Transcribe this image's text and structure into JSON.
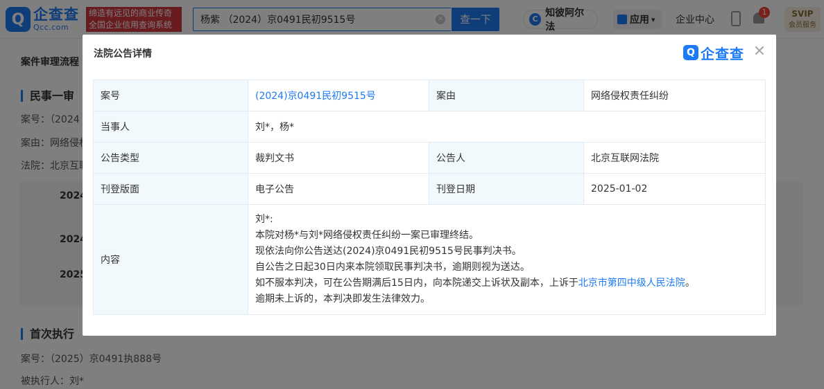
{
  "header": {
    "logo_mark": "Q",
    "logo_cn": "企查查",
    "logo_en": "Qcc.com",
    "slogan_line1": "缔造有远见的商业传奇",
    "slogan_line2": "全国企业信用查询系统",
    "search_value": "杨紫 （2024）京0491民初9515号",
    "search_clear": "✕",
    "search_button": "查一下",
    "zhibi_icon": "C",
    "zhibi_label": "知彼阿尔法",
    "apps_label": "应用",
    "apps_caret": "▾",
    "center_label": "企业中心",
    "notification_count": "1",
    "svip_title": "SVIP",
    "svip_sub": "会员服务"
  },
  "background": {
    "process_title": "案件审理流程",
    "first_trial_title": "民事一审",
    "case_no_line": "案号：（2024",
    "cause_line": "案由：网络侵权",
    "court_line": "法院：北京互联",
    "timeline_items": [
      "2024",
      "2024",
      "2025"
    ],
    "exec_title": "首次执行",
    "exec_case_line": "案号：（2025）京0491执888号",
    "exec_person_line": "被执行人：刘*"
  },
  "modal": {
    "title": "法院公告详情",
    "logo_mark": "Q",
    "logo_text": "企查查",
    "close": "✕",
    "rows": {
      "case_no_label": "案号",
      "case_no_value": "(2024)京0491民初9515号",
      "cause_label": "案由",
      "cause_value": "网络侵权责任纠纷",
      "parties_label": "当事人",
      "parties_value": "刘*，杨*",
      "type_label": "公告类型",
      "type_value": "裁判文书",
      "announcer_label": "公告人",
      "announcer_value": "北京互联网法院",
      "layout_label": "刊登版面",
      "layout_value": "电子公告",
      "date_label": "刊登日期",
      "date_value": "2025-01-02",
      "content_label": "内容"
    },
    "content": {
      "line1": "刘*:",
      "line2": "本院对杨*与刘*网络侵权责任纠纷一案已审理终结。",
      "line3": "现依法向你公告送达(2024)京0491民初9515号民事判决书。",
      "line4": "自公告之日起30日内来本院领取民事判决书，逾期则视为送达。",
      "line5_pre": "如不服本判决，可在公告期满后15日内，向本院递交上诉状及副本，上诉于",
      "line5_link": "北京市第四中级人民法院",
      "line5_post": "。",
      "line6": "逾期未上诉的，本判决即发生法律效力。"
    }
  }
}
